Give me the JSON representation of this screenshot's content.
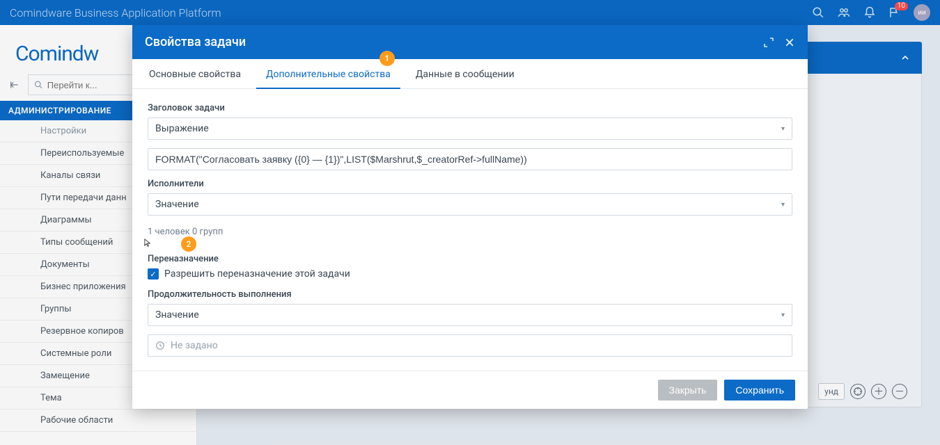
{
  "header": {
    "title": "Comindware Business Application Platform",
    "notif_count": "10",
    "avatar_initials": "ии"
  },
  "brand": "Comindw",
  "search": {
    "placeholder": "Перейти к..."
  },
  "sidebar": {
    "section": "АДМИНИСТРИРОВАНИЕ",
    "items": [
      {
        "label": "Настройки"
      },
      {
        "label": "Переиспользуемые"
      },
      {
        "label": "Каналы связи"
      },
      {
        "label": "Пути передачи данн"
      },
      {
        "label": "Диаграммы"
      },
      {
        "label": "Типы сообщений"
      },
      {
        "label": "Документы"
      },
      {
        "label": "Бизнес приложения"
      },
      {
        "label": "Группы"
      },
      {
        "label": "Резервное копиров"
      },
      {
        "label": "Системные роли"
      },
      {
        "label": "Замещение"
      },
      {
        "label": "Тема"
      },
      {
        "label": "Рабочие области"
      }
    ]
  },
  "panel": {
    "footer_hint": "унд"
  },
  "modal": {
    "title": "Свойства задачи",
    "tabs": [
      {
        "label": "Основные свойства"
      },
      {
        "label": "Дополнительные свойства"
      },
      {
        "label": "Данные в сообщении"
      }
    ],
    "badges": {
      "b1": "1",
      "b2": "2"
    },
    "task_title_label": "Заголовок задачи",
    "task_title_mode": "Выражение",
    "task_title_expr": "FORMAT(\"Согласовать заявку ({0} — {1})\",LIST($Marshrut,$_creatorRef->fullName))",
    "assignees_label": "Исполнители",
    "assignees_mode": "Значение",
    "assignees_summary": "1 человек 0 групп",
    "reassign_label": "Переназначение",
    "reassign_check_label": "Разрешить переназначение этой задачи",
    "duration_label": "Продолжительность выполнения",
    "duration_mode": "Значение",
    "duration_placeholder": "Не задано",
    "btn_close": "Закрыть",
    "btn_save": "Сохранить"
  }
}
